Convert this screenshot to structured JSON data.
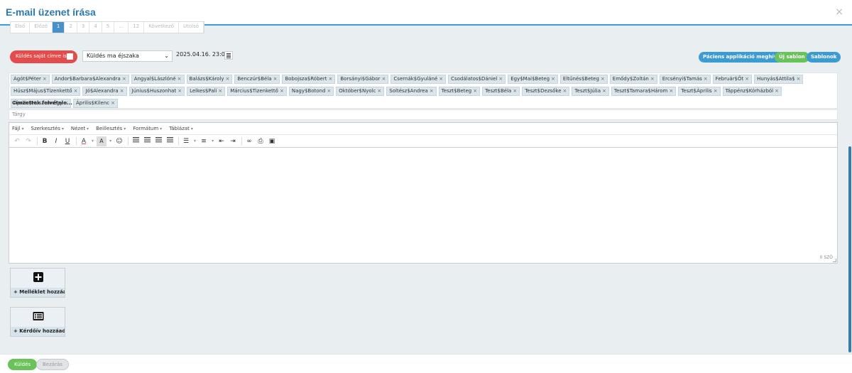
{
  "modal": {
    "title": "E-mail üzenet írása",
    "close": "×"
  },
  "pagination": {
    "items": [
      "Első",
      "Előző",
      "1",
      "2",
      "3",
      "4",
      "5",
      "…",
      "12",
      "Következő",
      "Utolsó"
    ],
    "active_index": 2
  },
  "toolbar": {
    "self_send_label": "Küldés saját címre is",
    "send_time_select": "Küldés ma éjszaka",
    "datetime": "2025.04.16. 23:00",
    "invite_app": "Páciens applikáció meghívó",
    "new_template": "Új sablon",
    "templates": "Sablonok"
  },
  "recipients": {
    "chips": [
      "Agót$Péter",
      "Andor$Barbara$Alexandra",
      "Angyal$Lászlóné",
      "Balázs$Károly",
      "Benczúr$Béla",
      "Bobojsza$Róbert",
      "Borsányi$Gábor",
      "Csernák$Gyuláné",
      "Csodálatos$Dániel",
      "Egy$Mai$Beteg",
      "Eltűnés$Beteg",
      "Emődy$Zoltán",
      "Ercsényi$Tamás",
      "Február$Öt",
      "Hunyás$Attila$",
      "Húsz$Május$Tizenkettő",
      "Jó$Alexandra",
      "Június$Huszonhat",
      "Lelkes$Pali",
      "Március$Tizenkettő",
      "Nagy$Botond",
      "Október$Nyolc",
      "Soltész$Andrea",
      "Teszt$Beteg",
      "Teszt$Béla",
      "Teszt$Dezsőke",
      "Teszt$Júlia",
      "Teszt$Tamara$Három",
      "Teszt$Április",
      "Táppénz$Kórházból",
      "Április$Huszonnégy",
      "Április$Kilenc"
    ],
    "add_label": "Címzettek felvétele..."
  },
  "subject": {
    "placeholder": "Tárgy"
  },
  "editor": {
    "menu": [
      "Fájl",
      "Szerkesztés",
      "Nézet",
      "Beillesztés",
      "Formátum",
      "Táblázat"
    ],
    "wordcount": "0 SZÓ"
  },
  "tiles": {
    "attachment_label": "+ Melléklet hozzáa...",
    "questionnaire_label": "+ Kérdőív hozzáad..."
  },
  "footer": {
    "send": "Küldés",
    "close": "Bezárás"
  },
  "colors": {
    "accent": "#3aa0d3",
    "danger": "#e44b4b",
    "success": "#6ac25b"
  }
}
